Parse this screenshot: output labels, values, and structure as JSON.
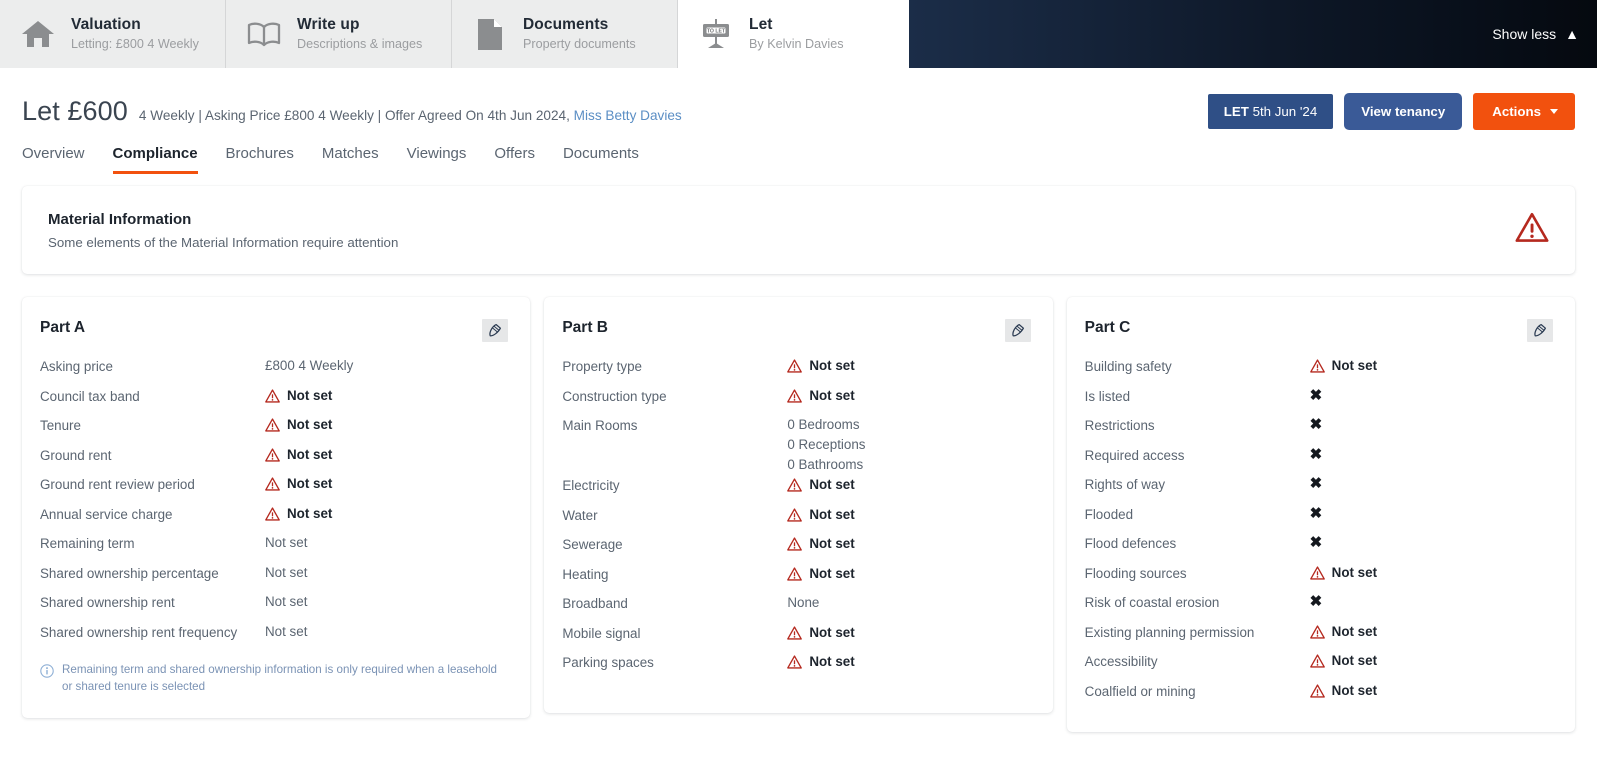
{
  "topbar": {
    "tabs": [
      {
        "icon": "home-icon",
        "title": "Valuation",
        "sub": "Letting: £800 4 Weekly",
        "active": false
      },
      {
        "icon": "book-icon",
        "title": "Write up",
        "sub": "Descriptions & images",
        "active": false
      },
      {
        "icon": "document-icon",
        "title": "Documents",
        "sub": "Property documents",
        "active": false
      },
      {
        "icon": "to-let-sign-icon",
        "title": "Let",
        "sub": "By Kelvin Davies",
        "active": true
      }
    ],
    "show_less_label": "Show less",
    "show_less_icon": "chevron-up-icon"
  },
  "title": {
    "heading": "Let £600",
    "meta_plain": "4 Weekly | Asking Price £800 4 Weekly | Offer Agreed On 4th Jun 2024,",
    "meta_link": "Miss Betty Davies"
  },
  "actions": {
    "let_badge_strong": "LET",
    "let_badge_date": "5th Jun '24",
    "view_tenancy_label": "View tenancy",
    "actions_label": "Actions",
    "actions_caret_icon": "caret-down-icon"
  },
  "subnav": {
    "items": [
      {
        "label": "Overview",
        "active": false
      },
      {
        "label": "Compliance",
        "active": true
      },
      {
        "label": "Brochures",
        "active": false
      },
      {
        "label": "Matches",
        "active": false
      },
      {
        "label": "Viewings",
        "active": false
      },
      {
        "label": "Offers",
        "active": false
      },
      {
        "label": "Documents",
        "active": false
      }
    ]
  },
  "material_information": {
    "title": "Material Information",
    "subtitle": "Some elements of the Material Information require attention",
    "status_icon": "warning-triangle-icon"
  },
  "parts": [
    {
      "title": "Part A",
      "edit_icon": "edit-pencil-icon",
      "rows": [
        {
          "label": "Asking price",
          "value": "£800 4 Weekly",
          "state": "plain"
        },
        {
          "label": "Council tax band",
          "value": "Not set",
          "state": "warning"
        },
        {
          "label": "Tenure",
          "value": "Not set",
          "state": "warning"
        },
        {
          "label": "Ground rent",
          "value": "Not set",
          "state": "warning"
        },
        {
          "label": "Ground rent review period",
          "value": "Not set",
          "state": "warning"
        },
        {
          "label": "Annual service charge",
          "value": "Not set",
          "state": "warning"
        },
        {
          "label": "Remaining term",
          "value": "Not set",
          "state": "plain"
        },
        {
          "label": "Shared ownership percentage",
          "value": "Not set",
          "state": "plain"
        },
        {
          "label": "Shared ownership rent",
          "value": "Not set",
          "state": "plain"
        },
        {
          "label": "Shared ownership rent frequency",
          "value": "Not set",
          "state": "plain"
        }
      ],
      "note": "Remaining term and shared ownership information is only required when a leasehold or shared tenure is selected",
      "note_icon": "info-circle-icon"
    },
    {
      "title": "Part B",
      "edit_icon": "edit-pencil-icon",
      "rows": [
        {
          "label": "Property type",
          "value": "Not set",
          "state": "warning"
        },
        {
          "label": "Construction type",
          "value": "Not set",
          "state": "warning"
        },
        {
          "label": "Main Rooms",
          "value": "0 Bedrooms\n0 Receptions\n0 Bathrooms",
          "state": "multiline"
        },
        {
          "label": "Electricity",
          "value": "Not set",
          "state": "warning"
        },
        {
          "label": "Water",
          "value": "Not set",
          "state": "warning"
        },
        {
          "label": "Sewerage",
          "value": "Not set",
          "state": "warning"
        },
        {
          "label": "Heating",
          "value": "Not set",
          "state": "warning"
        },
        {
          "label": "Broadband",
          "value": "None",
          "state": "plain"
        },
        {
          "label": "Mobile signal",
          "value": "Not set",
          "state": "warning"
        },
        {
          "label": "Parking spaces",
          "value": "Not set",
          "state": "warning"
        }
      ],
      "note": "",
      "note_icon": ""
    },
    {
      "title": "Part C",
      "edit_icon": "edit-pencil-icon",
      "rows": [
        {
          "label": "Building safety",
          "value": "Not set",
          "state": "warning"
        },
        {
          "label": "Is listed",
          "value": "",
          "state": "cross"
        },
        {
          "label": "Restrictions",
          "value": "",
          "state": "cross"
        },
        {
          "label": "Required access",
          "value": "",
          "state": "cross"
        },
        {
          "label": "Rights of way",
          "value": "",
          "state": "cross"
        },
        {
          "label": "Flooded",
          "value": "",
          "state": "cross"
        },
        {
          "label": "Flood defences",
          "value": "",
          "state": "cross"
        },
        {
          "label": "Flooding sources",
          "value": "Not set",
          "state": "warning"
        },
        {
          "label": "Risk of coastal erosion",
          "value": "",
          "state": "cross"
        },
        {
          "label": "Existing planning permission",
          "value": "Not set",
          "state": "warning"
        },
        {
          "label": "Accessibility",
          "value": "Not set",
          "state": "warning"
        },
        {
          "label": "Coalfield or mining",
          "value": "Not set",
          "state": "warning"
        }
      ],
      "note": "",
      "note_icon": ""
    }
  ],
  "colors": {
    "accent_orange": "#f2510e",
    "brand_blue": "#3a5a97",
    "let_blue": "#2f4f86",
    "warning_red": "#c0392b",
    "link_blue": "#5b8ec4",
    "muted_text": "#5b6571"
  }
}
